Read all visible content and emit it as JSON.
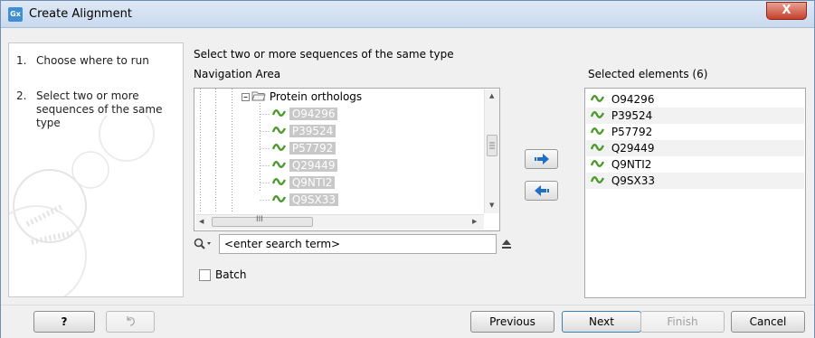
{
  "window": {
    "title": "Create Alignment",
    "app_icon_text": "Gx",
    "close_glyph": "X"
  },
  "steps": [
    {
      "number": "1.",
      "label": "Choose where to run"
    },
    {
      "number": "2.",
      "label": "Select two or more sequences of the same type"
    }
  ],
  "main": {
    "instruction": "Select two or more sequences of the same type",
    "nav_label": "Navigation Area",
    "selected_label": "Selected elements (6)"
  },
  "tree": {
    "folder_label": "Protein orthologs",
    "items": [
      "O94296",
      "P39524",
      "P57792",
      "Q29449",
      "Q9NTI2",
      "Q9SX33"
    ],
    "hscroll_grip": "III"
  },
  "search": {
    "placeholder": "<enter search term>"
  },
  "batch": {
    "label": "Batch",
    "checked": false
  },
  "selected": {
    "items": [
      "O94296",
      "P39524",
      "P57792",
      "Q29449",
      "Q9NTI2",
      "Q9SX33"
    ]
  },
  "footer": {
    "help_label": "?",
    "previous_label": "Previous",
    "next_label": "Next",
    "finish_label": "Finish",
    "cancel_label": "Cancel"
  },
  "colors": {
    "sequence_icon": "#4a9a2a",
    "arrow_blue": "#1f6fc4",
    "selection_gray": "#c8c8c8"
  }
}
